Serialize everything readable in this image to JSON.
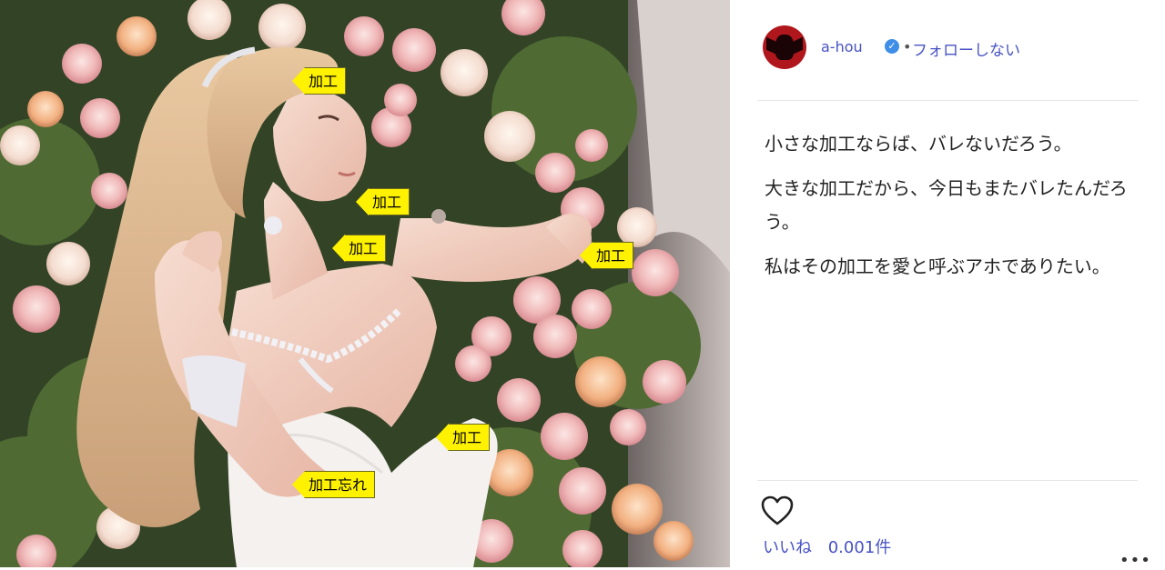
{
  "post": {
    "photo_alt": "woman in wedding dress",
    "annotations": [
      "加工",
      "加工",
      "加工",
      "加工",
      "加工",
      "加工忘れ"
    ],
    "user": {
      "name": "a-hou",
      "follow_label": "フォローしない",
      "separator": "•"
    },
    "caption": [
      "小さな加工ならば、バレないだろう。",
      "大きな加工だから、今日もまたバレたんだろう。",
      "私はその加工を愛と呼ぶアホでありたい。"
    ],
    "likes": {
      "label": "いいね",
      "count": "0.001件"
    },
    "icons": [
      "verified-badge-icon",
      "heart-icon",
      "more-options-icon"
    ],
    "colors": {
      "link": "#4752c4",
      "verified": "#3e8ee8",
      "label_bg": "#fff200"
    }
  }
}
